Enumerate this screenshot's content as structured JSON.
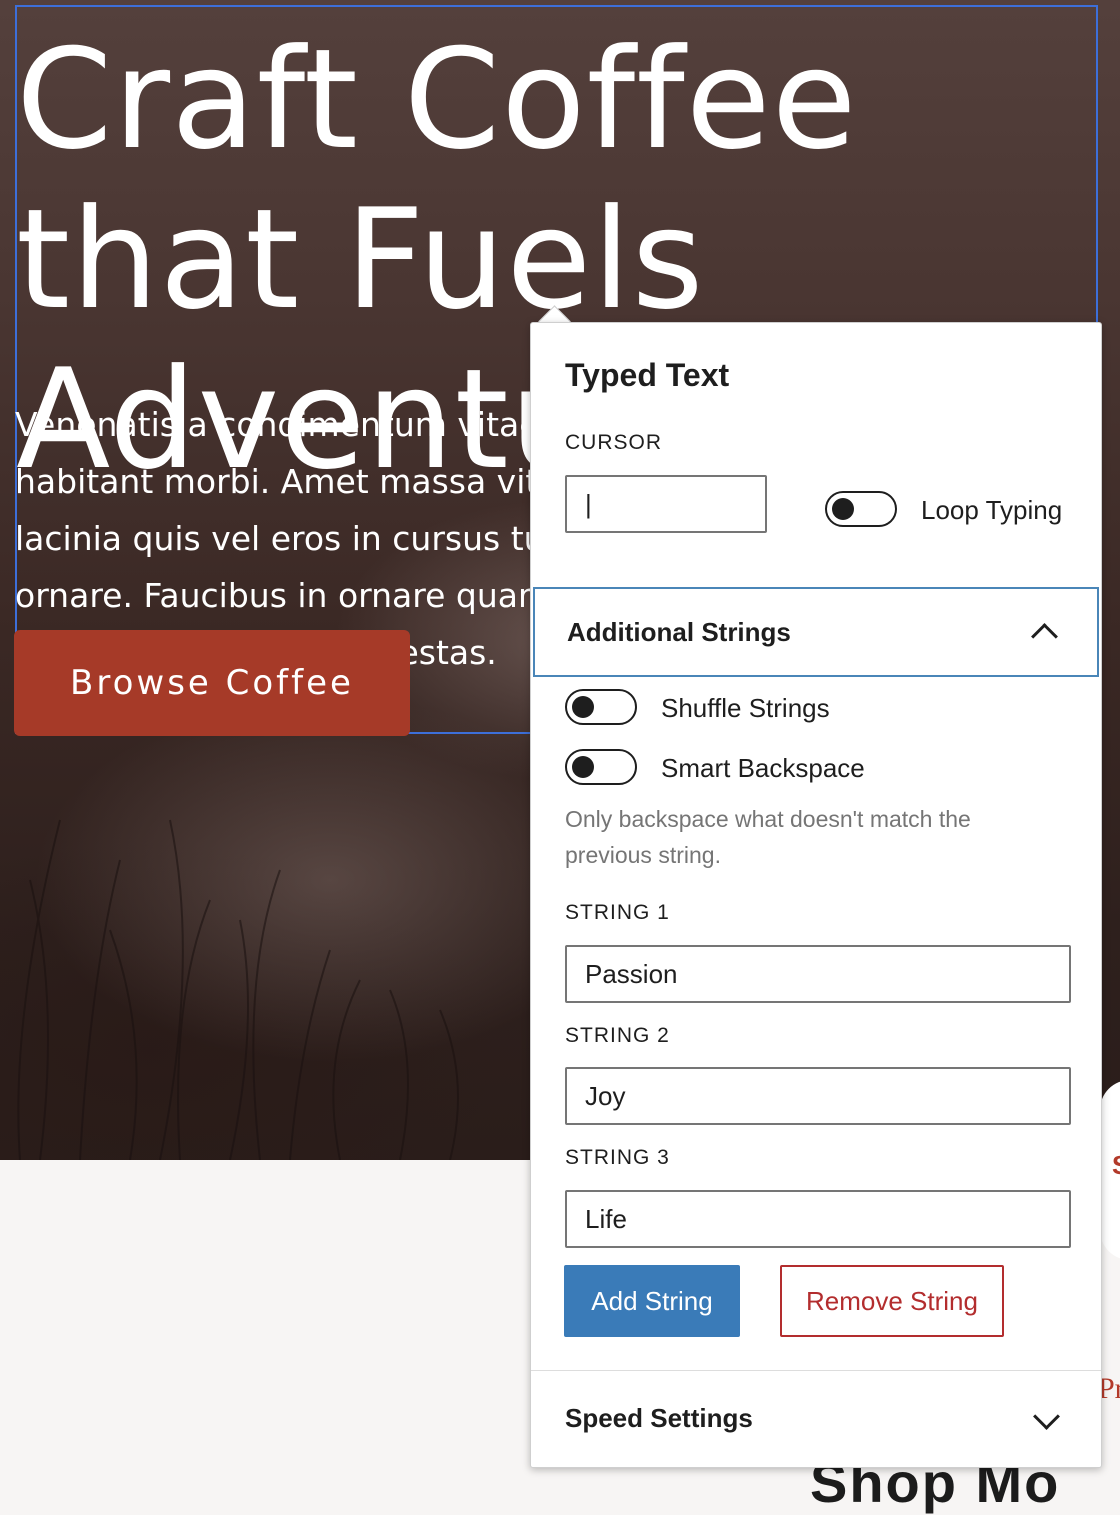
{
  "hero": {
    "title": "Craft Coffee that Fuels Adventure",
    "body": "Venenatis a condimentum vitae sapien pellentesque habitant morbi. Amet massa vitae tortor condimentum lacinia quis vel eros in cursus turpis massa tincidunt dui ut ornare. Faucibus in ornare quam viverra orci sagittis eu volutpat odio neque egestas.",
    "cta_label": "Browse Coffee"
  },
  "background_partial": {
    "shop_more": "Shop Mo",
    "right_mark": "S",
    "right_text": "Pr"
  },
  "panel": {
    "title": "Typed Text",
    "cursor_label": "CURSOR",
    "cursor_value": "|",
    "loop_typing_label": "Loop Typing",
    "loop_typing_on": false,
    "additional_strings": {
      "title": "Additional Strings",
      "expanded": true,
      "shuffle_label": "Shuffle Strings",
      "shuffle_on": false,
      "smart_backspace_label": "Smart Backspace",
      "smart_backspace_on": false,
      "smart_backspace_help": "Only backspace what doesn't match the previous string.",
      "strings": [
        {
          "label": "STRING 1",
          "value": "Passion"
        },
        {
          "label": "STRING 2",
          "value": "Joy"
        },
        {
          "label": "STRING 3",
          "value": "Life"
        }
      ],
      "add_button": "Add String",
      "remove_button": "Remove String"
    },
    "speed_settings": {
      "title": "Speed Settings",
      "expanded": false
    }
  },
  "colors": {
    "accent_blue": "#3a7bb8",
    "cta_red": "#a63a28",
    "danger_red": "#b32d2e",
    "selection_blue": "#3d6fd9"
  }
}
